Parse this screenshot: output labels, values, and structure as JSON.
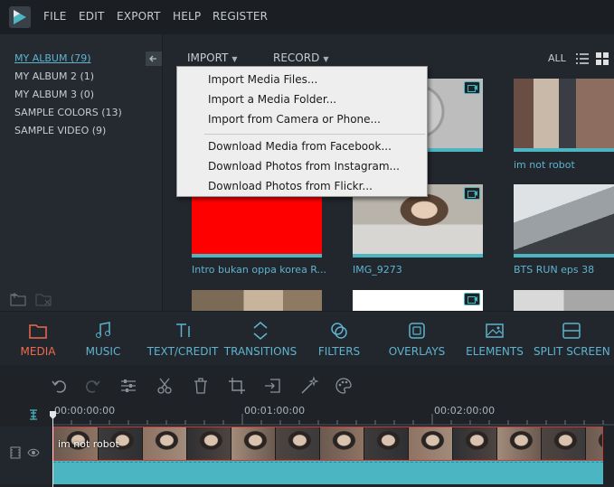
{
  "menubar": {
    "items": [
      "FILE",
      "EDIT",
      "EXPORT",
      "HELP",
      "REGISTER"
    ]
  },
  "sidebar": {
    "albums": [
      {
        "label": "MY ALBUM (79)",
        "active": true
      },
      {
        "label": "MY ALBUM 2 (1)",
        "active": false
      },
      {
        "label": "MY ALBUM 3 (0)",
        "active": false
      },
      {
        "label": "SAMPLE COLORS (13)",
        "active": false
      },
      {
        "label": "SAMPLE VIDEO (9)",
        "active": false
      }
    ],
    "collapse_icon": "arrow-left-icon"
  },
  "toolbar": {
    "import_label": "IMPORT",
    "record_label": "RECORD",
    "filter_label": "ALL"
  },
  "import_menu": {
    "items": [
      "Import Media Files...",
      "Import a Media Folder...",
      "Import from Camera or Phone...",
      "Download Media from Facebook...",
      "Download Photos from Instagram...",
      "Download Photos from Flickr..."
    ]
  },
  "media": {
    "tiles": [
      {
        "label": "",
        "kind": "video"
      },
      {
        "label": "im not robot",
        "kind": "image"
      },
      {
        "label": "Intro bukan oppa korea R...",
        "kind": "image"
      },
      {
        "label": "IMG_9273",
        "kind": "video"
      },
      {
        "label": "BTS RUN eps 38",
        "kind": "image"
      },
      {
        "label": "",
        "kind": "image"
      },
      {
        "label": "",
        "kind": "video"
      },
      {
        "label": "",
        "kind": "image"
      }
    ]
  },
  "tabs": [
    {
      "label": "MEDIA",
      "icon": "folder-icon",
      "active": true
    },
    {
      "label": "MUSIC",
      "icon": "music-note-icon",
      "active": false
    },
    {
      "label": "TEXT/CREDIT",
      "icon": "text-icon",
      "active": false
    },
    {
      "label": "TRANSITIONS",
      "icon": "transition-arrows-icon",
      "active": false
    },
    {
      "label": "FILTERS",
      "icon": "filter-circles-icon",
      "active": false
    },
    {
      "label": "OVERLAYS",
      "icon": "overlay-icon",
      "active": false
    },
    {
      "label": "ELEMENTS",
      "icon": "image-icon",
      "active": false
    },
    {
      "label": "SPLIT SCREEN",
      "icon": "split-screen-icon",
      "active": false
    }
  ],
  "timeline": {
    "tools": [
      "undo-icon",
      "redo-icon",
      "adjust-icon",
      "cut-icon",
      "delete-icon",
      "crop-icon",
      "export-frame-icon",
      "magic-wand-icon",
      "palette-icon"
    ],
    "timestamps": [
      "00:00:00:00",
      "00:01:00:00",
      "00:02:00:00"
    ],
    "clip_label": "im not robot"
  },
  "colors": {
    "accent": "#5fb3ce",
    "active_tab": "#ef6a4c",
    "clip_audio": "#4bb6c1",
    "clip_border": "#c93a3a"
  }
}
